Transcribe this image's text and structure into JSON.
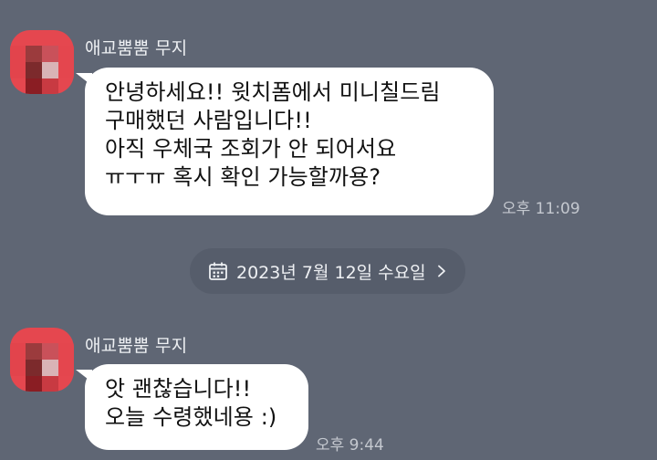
{
  "messages": [
    {
      "sender": "애교뿜뿜 무지",
      "lines": [
        "안녕하세요!! 윗치폼에서 미니칠드림",
        "구매했던 사람입니다!!",
        "아직 우체국 조회가 안 되어서요",
        "ㅠㅜㅠ 혹시 확인 가능할까용?"
      ],
      "time": "오후 11:09"
    },
    {
      "sender": "애교뿜뿜 무지",
      "lines": [
        "앗 괜찮습니다!!",
        "오늘 수령했네용 :)"
      ],
      "time": "오후 9:44"
    }
  ],
  "date_divider": {
    "label": "2023년 7월 12일 수요일",
    "icon": "calendar-icon",
    "action_icon": "chevron-right-icon"
  },
  "colors": {
    "background": "#5f6674",
    "bubble": "#ffffff",
    "avatar_base": "#e5474f",
    "date_pill": "#565d6b"
  }
}
